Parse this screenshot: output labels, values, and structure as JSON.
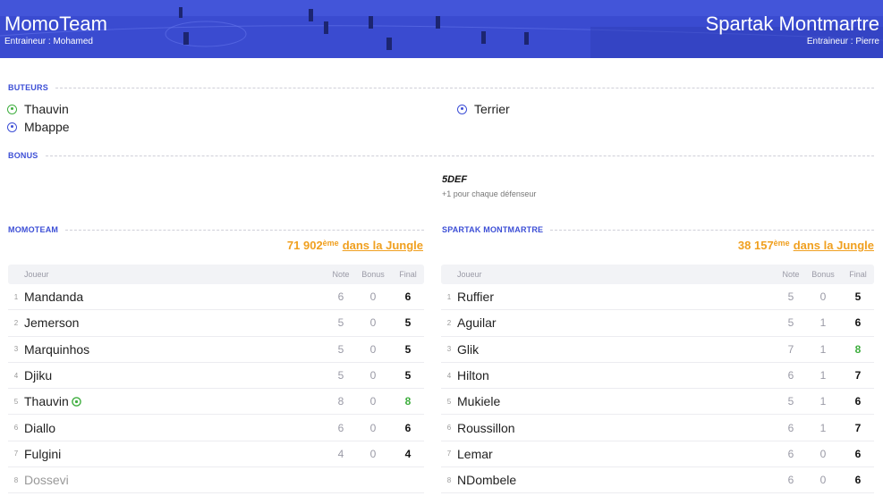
{
  "header": {
    "home": {
      "name": "MomoTeam",
      "coach": "Entraineur : Mohamed"
    },
    "away": {
      "name": "Spartak Montmartre",
      "coach": "Entraineur : Pierre"
    }
  },
  "sections": {
    "scorers_label": "BUTEURS",
    "bonus_label": "BONUS"
  },
  "scorers": {
    "home": [
      {
        "name": "Thauvin",
        "icon": "ball-green-icon"
      },
      {
        "name": "Mbappe",
        "icon": "ball-blue-icon"
      }
    ],
    "away": [
      {
        "name": "Terrier",
        "icon": "ball-blue-icon"
      }
    ]
  },
  "bonus": {
    "away": {
      "title": "5DEF",
      "desc": "+1 pour chaque défenseur"
    }
  },
  "home_team": {
    "label": "MOMOTEAM",
    "rank_num": "71 902",
    "rank_sup": "ème",
    "rank_link": "dans la Jungle",
    "columns": {
      "player": "Joueur",
      "note": "Note",
      "bonus": "Bonus",
      "final": "Final"
    },
    "players": [
      {
        "idx": "1",
        "name": "Mandanda",
        "note": "6",
        "bonus": "0",
        "final": "6"
      },
      {
        "idx": "2",
        "name": "Jemerson",
        "note": "5",
        "bonus": "0",
        "final": "5"
      },
      {
        "idx": "3",
        "name": "Marquinhos",
        "note": "5",
        "bonus": "0",
        "final": "5"
      },
      {
        "idx": "4",
        "name": "Djiku",
        "note": "5",
        "bonus": "0",
        "final": "5"
      },
      {
        "idx": "5",
        "name": "Thauvin",
        "note": "8",
        "bonus": "0",
        "final": "8"
      },
      {
        "idx": "6",
        "name": "Diallo",
        "note": "6",
        "bonus": "0",
        "final": "6"
      },
      {
        "idx": "7",
        "name": "Fulgini",
        "note": "4",
        "bonus": "0",
        "final": "4"
      },
      {
        "idx": "8",
        "name": "Dossevi",
        "note": "",
        "bonus": "",
        "final": ""
      }
    ]
  },
  "away_team": {
    "label": "SPARTAK MONTMARTRE",
    "rank_num": "38 157",
    "rank_sup": "ème",
    "rank_link": "dans la Jungle",
    "columns": {
      "player": "Joueur",
      "note": "Note",
      "bonus": "Bonus",
      "final": "Final"
    },
    "players": [
      {
        "idx": "1",
        "name": "Ruffier",
        "note": "5",
        "bonus": "0",
        "final": "5"
      },
      {
        "idx": "2",
        "name": "Aguilar",
        "note": "5",
        "bonus": "1",
        "final": "6"
      },
      {
        "idx": "3",
        "name": "Glik",
        "note": "7",
        "bonus": "1",
        "final": "8"
      },
      {
        "idx": "4",
        "name": "Hilton",
        "note": "6",
        "bonus": "1",
        "final": "7"
      },
      {
        "idx": "5",
        "name": "Mukiele",
        "note": "5",
        "bonus": "1",
        "final": "6"
      },
      {
        "idx": "6",
        "name": "Roussillon",
        "note": "6",
        "bonus": "1",
        "final": "7"
      },
      {
        "idx": "7",
        "name": "Lemar",
        "note": "6",
        "bonus": "0",
        "final": "6"
      },
      {
        "idx": "8",
        "name": "NDombele",
        "note": "6",
        "bonus": "0",
        "final": "6"
      }
    ]
  },
  "colors": {
    "brand": "#3d4fd6",
    "rank": "#f0a020",
    "highlight": "#3fae3f"
  }
}
